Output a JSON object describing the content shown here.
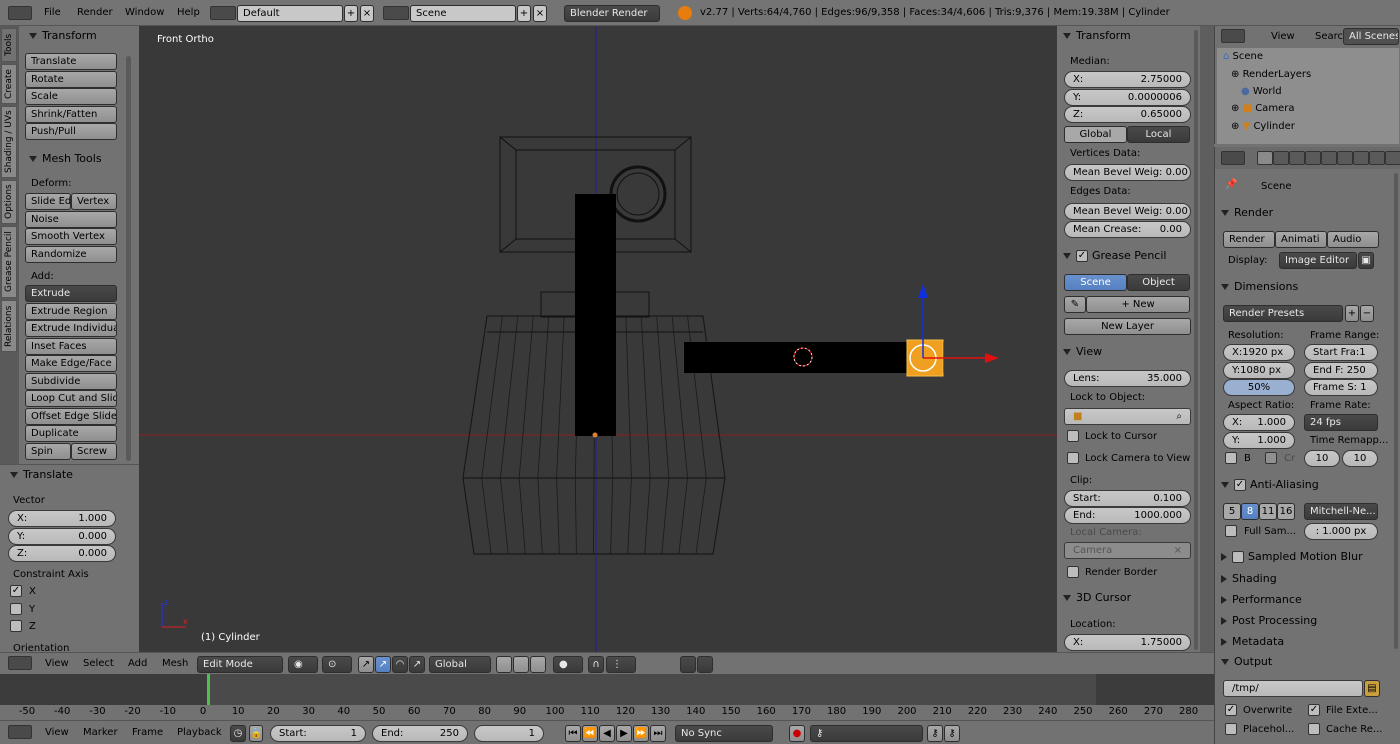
{
  "topbar": {
    "menus": [
      "File",
      "Render",
      "Window",
      "Help"
    ],
    "layout": "Default",
    "scene": "Scene",
    "engine": "Blender Render",
    "stats": "v2.77 | Verts:64/4,760 | Edges:96/9,358 | Faces:34/4,606 | Tris:9,376 | Mem:19.38M | Cylinder"
  },
  "left_tabs": [
    "Tools",
    "Create",
    "Shading / UVs",
    "Options",
    "Grease Pencil",
    "Relations"
  ],
  "tools": {
    "transform_title": "Transform",
    "transform_btns": [
      "Translate",
      "Rotate",
      "Scale",
      "Shrink/Fatten",
      "Push/Pull"
    ],
    "mesh_title": "Mesh Tools",
    "deform_label": "Deform:",
    "slide_edge": "Slide Ed",
    "vertex": "Vertex",
    "noise": "Noise",
    "smooth_vertex": "Smooth Vertex",
    "randomize": "Randomize",
    "add_label": "Add:",
    "extrude": "Extrude",
    "add_btns": [
      "Extrude Region",
      "Extrude Individual",
      "Inset Faces",
      "Make Edge/Face",
      "Subdivide",
      "Loop Cut and Slide",
      "Offset Edge Slide",
      "Duplicate"
    ],
    "spin": "Spin",
    "screw": "Screw"
  },
  "operator": {
    "title": "Translate",
    "vector_label": "Vector",
    "x_label": "X:",
    "x": "1.000",
    "y_label": "Y:",
    "y": "0.000",
    "z_label": "Z:",
    "z": "0.000",
    "constraint_label": "Constraint Axis",
    "ax": "X",
    "ay": "Y",
    "az": "Z",
    "orientation": "Orientation"
  },
  "viewport": {
    "view_name": "Front Ortho",
    "object_label": "(1) Cylinder"
  },
  "props": {
    "transform_title": "Transform",
    "median": "Median:",
    "x_label": "X:",
    "x": "2.75000",
    "y_label": "Y:",
    "y": "0.0000006",
    "z_label": "Z:",
    "z": "0.65000",
    "global": "Global",
    "local": "Local",
    "vertices_data": "Vertices Data:",
    "mean_bevel_v": "Mean Bevel Weig: 0.00",
    "edges_data": "Edges Data:",
    "mean_bevel_e": "Mean Bevel Weig: 0.00",
    "mean_crease_label": "Mean Crease:",
    "mean_crease": "0.00",
    "grease_title": "Grease Pencil",
    "gp_scene": "Scene",
    "gp_object": "Object",
    "gp_new": "New",
    "gp_new_layer": "New Layer",
    "view_title": "View",
    "lens_label": "Lens:",
    "lens": "35.000",
    "lock_object": "Lock to Object:",
    "lock_cursor": "Lock to Cursor",
    "lock_camera": "Lock Camera to View",
    "clip": "Clip:",
    "start_label": "Start:",
    "start": "0.100",
    "end_label": "End:",
    "end": "1000.000",
    "local_camera": "Local Camera:",
    "camera": "Camera",
    "render_border": "Render Border",
    "cursor_title": "3D Cursor",
    "location": "Location:",
    "cx_label": "X:",
    "cx": "1.75000"
  },
  "outliner": {
    "view": "View",
    "search": "Search",
    "all_scenes": "All Scenes",
    "items": [
      "Scene",
      "RenderLayers",
      "World",
      "Camera",
      "Cylinder"
    ]
  },
  "render": {
    "scene": "Scene",
    "render_title": "Render",
    "render_btn": "Render",
    "anim_btn": "Animati",
    "audio_btn": "Audio",
    "display_label": "Display:",
    "display": "Image Editor",
    "dim_title": "Dimensions",
    "presets": "Render Presets",
    "resolution": "Resolution:",
    "frame_range": "Frame Range:",
    "resx": "X:1920 px",
    "resy": "Y:1080 px",
    "pct": "50%",
    "start": "Start Fra:1",
    "end": "End F: 250",
    "step": "Frame S: 1",
    "aspect": "Aspect Ratio:",
    "frame_rate": "Frame Rate:",
    "ax": "X:",
    "axv": "1.000",
    "ay": "Y:",
    "ayv": "1.000",
    "fps": "24 fps",
    "remap": "Time Remapp...",
    "r1": "10",
    "r2": "10",
    "b": "B",
    "cr": "Cr",
    "aa_title": "Anti-Aliasing",
    "aa_vals": [
      "5",
      "8",
      "11",
      "16"
    ],
    "filter": "Mitchell-Ne...",
    "full_sample": "Full Sam...",
    "filter_size": ": 1.000 px",
    "sections": [
      "Sampled Motion Blur",
      "Shading",
      "Performance",
      "Post Processing",
      "Metadata"
    ],
    "output_title": "Output",
    "output_path": "/tmp/",
    "overwrite": "Overwrite",
    "file_ext": "File Exte...",
    "placeholders": "Placehol...",
    "cache": "Cache Re..."
  },
  "v3d_header": {
    "menus": [
      "View",
      "Select",
      "Add",
      "Mesh"
    ],
    "mode": "Edit Mode",
    "orientation": "Global"
  },
  "timeline": {
    "ticks": [
      "-50",
      "-40",
      "-30",
      "-20",
      "-10",
      "0",
      "10",
      "20",
      "30",
      "40",
      "50",
      "60",
      "70",
      "80",
      "90",
      "100",
      "110",
      "120",
      "130",
      "140",
      "150",
      "160",
      "170",
      "180",
      "190",
      "200",
      "210",
      "220",
      "230",
      "240",
      "250",
      "260",
      "270",
      "280"
    ],
    "menus": [
      "View",
      "Marker",
      "Frame",
      "Playback"
    ],
    "start_label": "Start:",
    "start": "1",
    "end_label": "End:",
    "end": "250",
    "current": "1",
    "sync": "No Sync"
  },
  "colors": {
    "viewport_bg": "#393939",
    "panel_bg": "#727272",
    "accent": "#5680c2",
    "selected_orange": "#f0a020"
  }
}
